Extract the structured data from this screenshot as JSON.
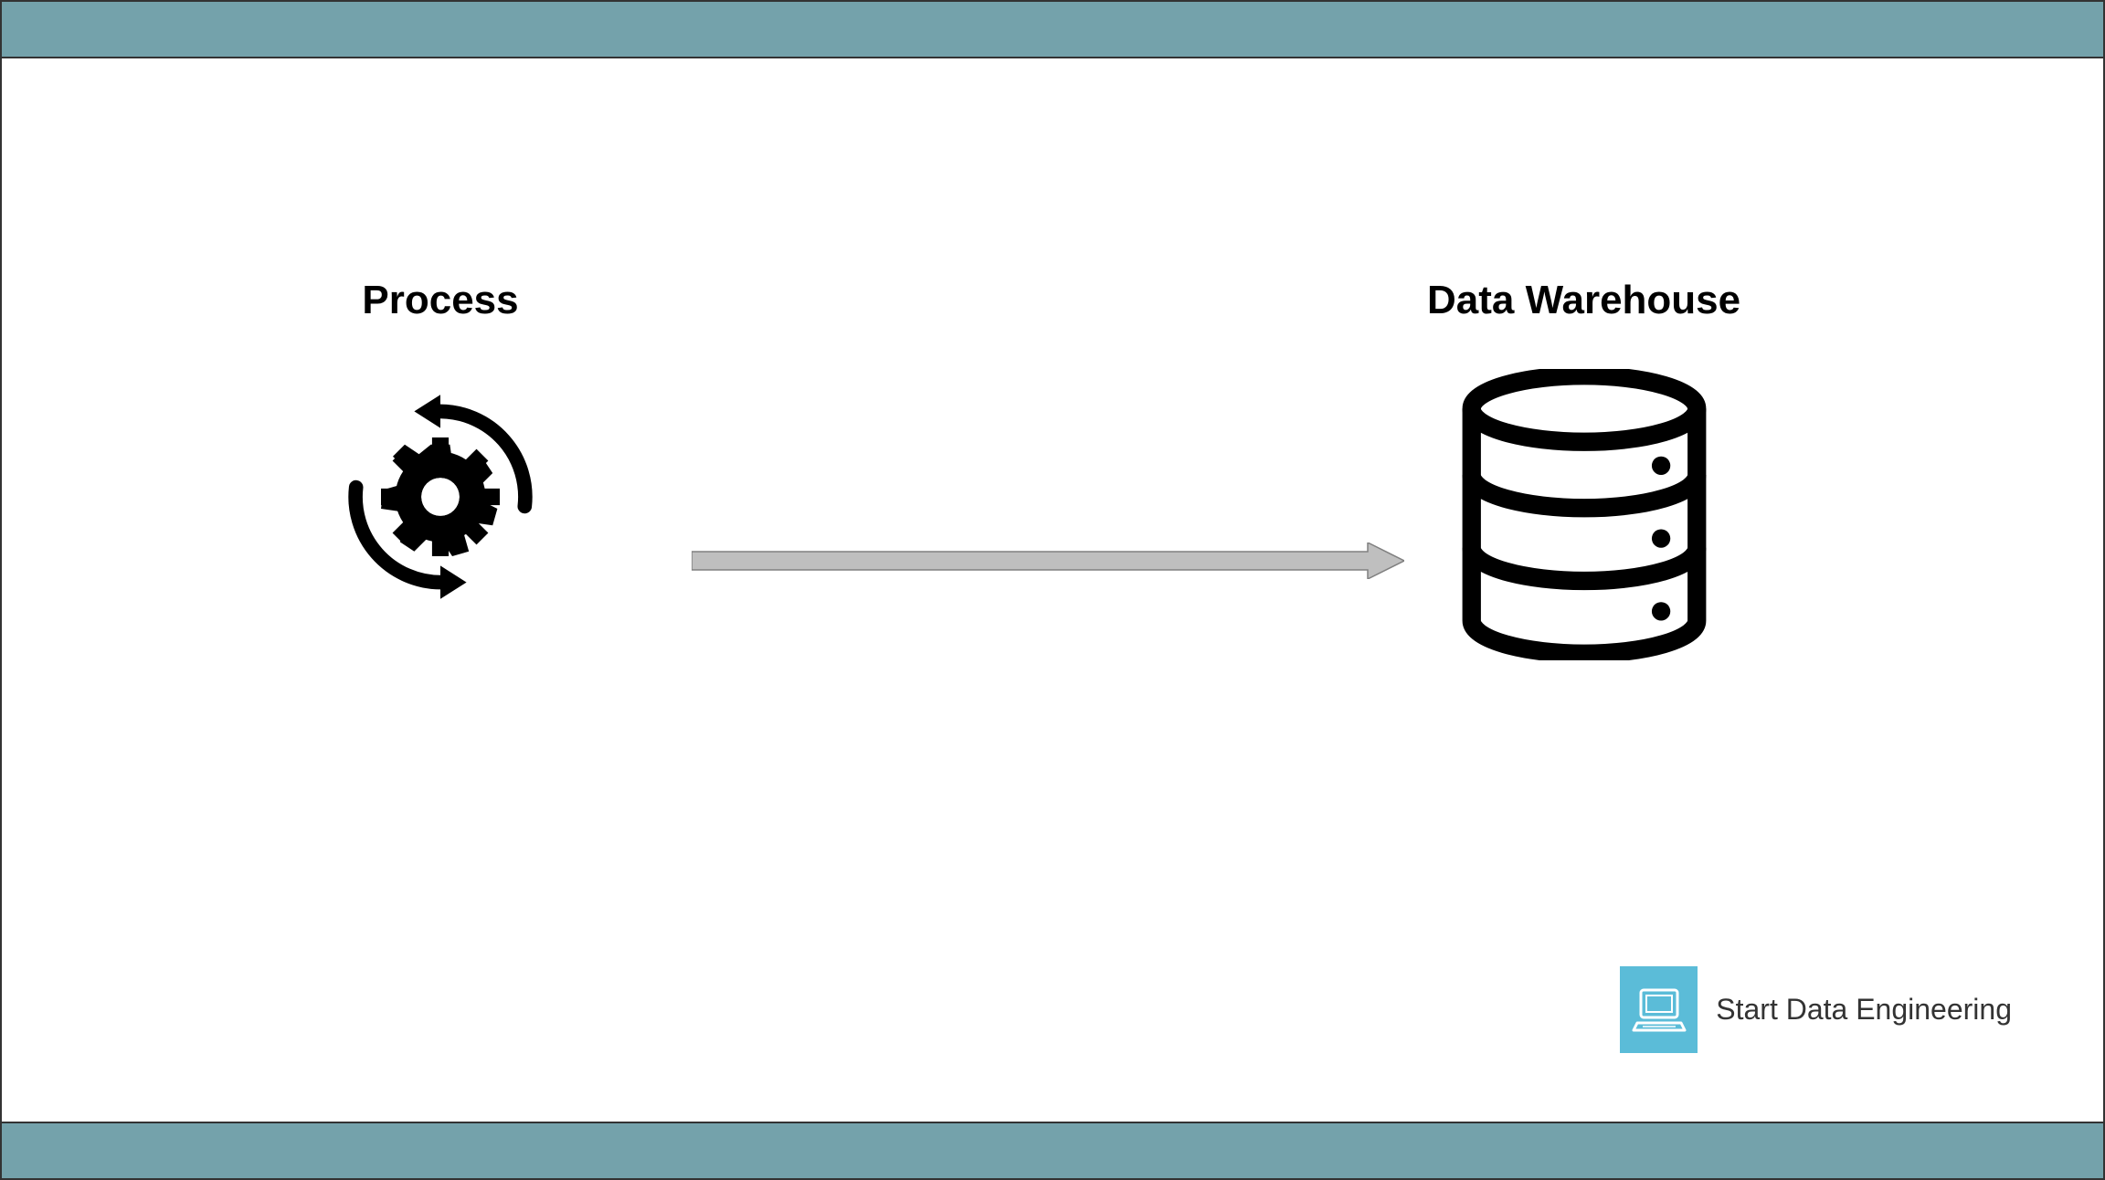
{
  "diagram": {
    "process_label": "Process",
    "warehouse_label": "Data Warehouse",
    "process_icon": "gear-cycle-icon",
    "warehouse_icon": "database-icon",
    "arrow_direction": "right"
  },
  "branding": {
    "text": "Start Data Engineering",
    "icon": "laptop-icon"
  },
  "colors": {
    "bar": "#74a2ab",
    "brand_icon_bg": "#5bbcd8",
    "arrow_fill": "#b8b8b8",
    "arrow_stroke": "#808080"
  }
}
